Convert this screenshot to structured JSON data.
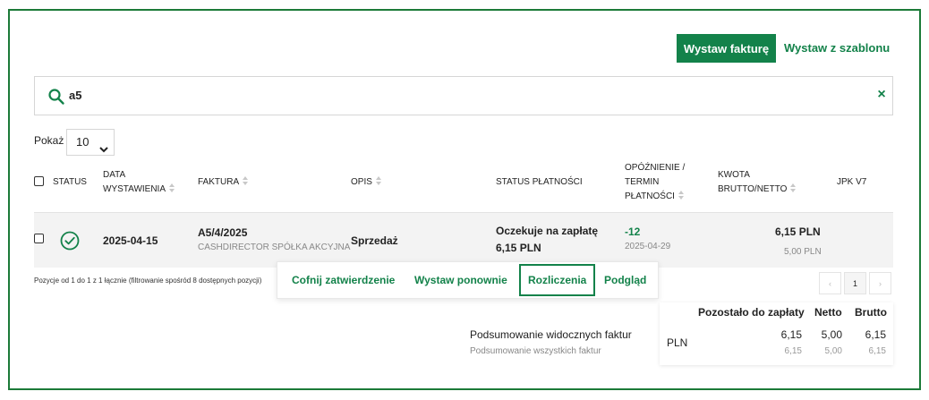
{
  "toolbar": {
    "issue_invoice_label": "Wystaw fakturę",
    "issue_from_template_label": "Wystaw z szablonu"
  },
  "search": {
    "value": "a5",
    "clear_label": "×"
  },
  "page_size": {
    "label": "Pokaż",
    "value": "10"
  },
  "table": {
    "headers": {
      "status": "STATUS",
      "date_line1": "DATA",
      "date_line2": "WYSTAWIENIA",
      "invoice": "FAKTURA",
      "description": "OPIS",
      "payment_status": "STATUS PŁATNOŚCI",
      "delay_line1": "OPÓŹNIENIE /",
      "delay_line2": "TERMIN",
      "delay_line3": "PŁATNOŚCI",
      "amount_line1": "KWOTA",
      "amount_line2": "BRUTTO/NETTO",
      "jpk": "JPK V7"
    },
    "rows": [
      {
        "date": "2025-04-15",
        "invoice_number": "A5/4/2025",
        "contractor": "CASHDIRECTOR SPÓŁKA AKCYJNA",
        "description": "Sprzedaż",
        "payment_status": "Oczekuje na zapłatę",
        "payment_amount": "6,15 PLN",
        "delay": "-12",
        "due_date": "2025-04-29",
        "gross": "6,15 PLN",
        "net": "5,00 PLN"
      }
    ]
  },
  "footer_info": "Pozycje od 1 do 1 z 1 łącznie (filtrowanie spośród 8 dostępnych pozycji)",
  "row_actions": {
    "revert": "Cofnij zatwierdzenie",
    "reissue": "Wystaw ponownie",
    "settlements": "Rozliczenia",
    "preview": "Podgląd"
  },
  "pagination": {
    "prev": "‹",
    "current": "1",
    "next": "›"
  },
  "summary": {
    "visible_label": "Podsumowanie widocznych faktur",
    "all_label": "Podsumowanie wszystkich faktur",
    "currency": "PLN",
    "col_remaining": "Pozostało do zapłaty",
    "col_net": "Netto",
    "col_gross": "Brutto",
    "visible": {
      "remaining": "6,15",
      "net": "5,00",
      "gross": "6,15"
    },
    "all": {
      "remaining": "6,15",
      "net": "5,00",
      "gross": "6,15"
    }
  },
  "colors": {
    "accent": "#13824a",
    "frame": "#1c7a38"
  },
  "icons": {
    "search": "search-icon",
    "clear": "close-icon",
    "status_ok": "check-circle-icon",
    "select": "chevron-down-icon"
  }
}
